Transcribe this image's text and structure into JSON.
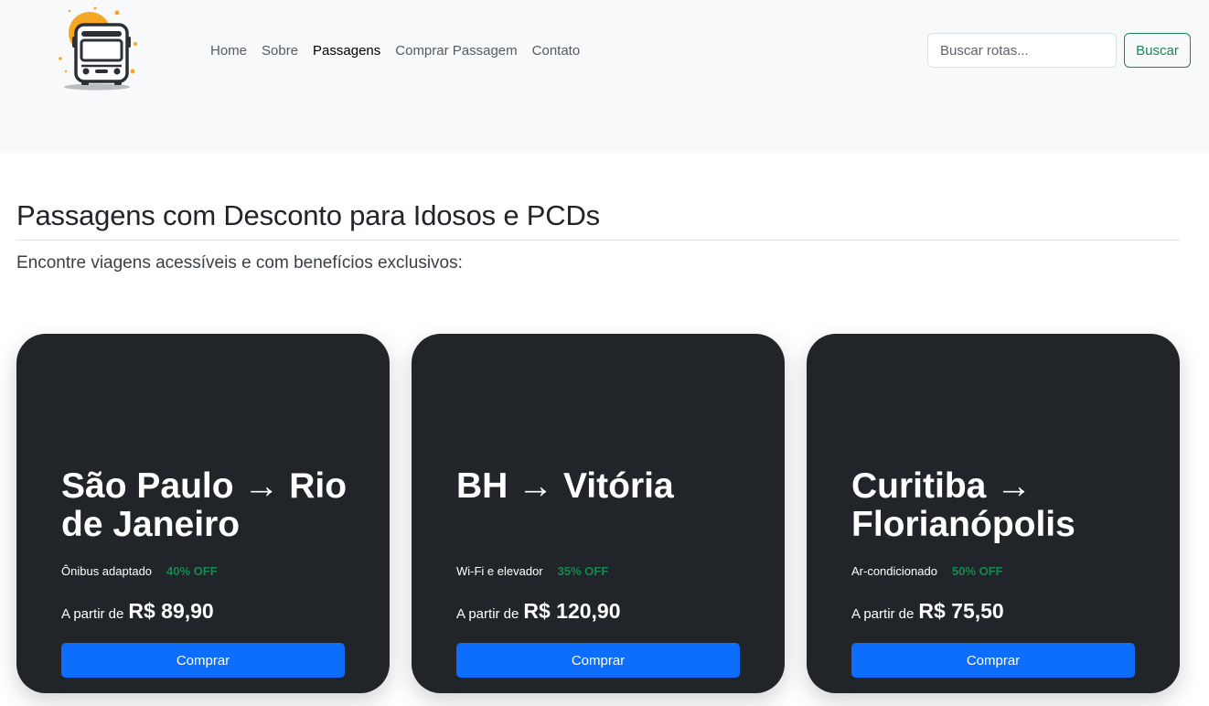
{
  "header": {
    "logo_icon": "bus-logo-icon",
    "nav": [
      {
        "label": "Home",
        "active": false
      },
      {
        "label": "Sobre",
        "active": false
      },
      {
        "label": "Passagens",
        "active": true
      },
      {
        "label": "Comprar Passagem",
        "active": false
      },
      {
        "label": "Contato",
        "active": false
      }
    ],
    "search": {
      "placeholder": "Buscar rotas...",
      "button_label": "Buscar"
    }
  },
  "main": {
    "title": "Passagens com Desconto para Idosos e PCDs",
    "subtitle": "Encontre viagens acessíveis e com benefícios exclusivos:"
  },
  "cards": [
    {
      "route": "São Paulo → Rio de Janeiro",
      "feature": "Ônibus adaptado",
      "discount": "40% OFF",
      "price_prefix": "A partir de",
      "price": "R$ 89,90",
      "button_label": "Comprar"
    },
    {
      "route": "BH → Vitória",
      "feature": "Wi-Fi e elevador",
      "discount": "35% OFF",
      "price_prefix": "A partir de",
      "price": "R$ 120,90",
      "button_label": "Comprar"
    },
    {
      "route": "Curitiba → Florianópolis",
      "feature": "Ar-condicionado",
      "discount": "50% OFF",
      "price_prefix": "A partir de",
      "price": "R$ 75,50",
      "button_label": "Comprar"
    }
  ],
  "colors": {
    "header_bg": "#f8f9fa",
    "card_bg": "#212529",
    "discount": "#198754",
    "button": "#0d6efd",
    "search_button": "#198754"
  }
}
